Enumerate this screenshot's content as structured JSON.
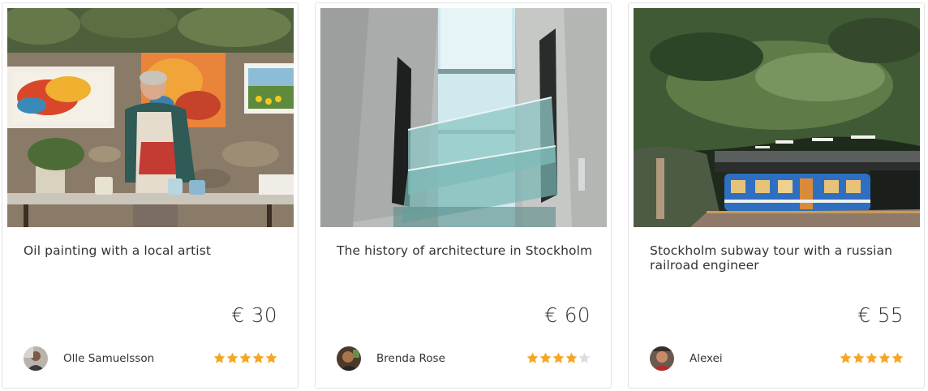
{
  "accent": {
    "star_filled": "#f5a623",
    "star_empty": "#dddddd"
  },
  "cards": [
    {
      "title": "Oil painting with a local artist",
      "price": "€ 30",
      "host": "Olle Samuelsson",
      "rating": 5,
      "image_icon": "artist-painting-photo"
    },
    {
      "title": "The history of architecture in Stockholm",
      "price": "€ 60",
      "host": "Brenda Rose",
      "rating": 4,
      "image_icon": "glass-atrium-photo"
    },
    {
      "title": "Stockholm subway tour with a russian railroad engineer",
      "price": "€ 55",
      "host": "Alexei",
      "rating": 5,
      "image_icon": "subway-station-photo"
    }
  ]
}
